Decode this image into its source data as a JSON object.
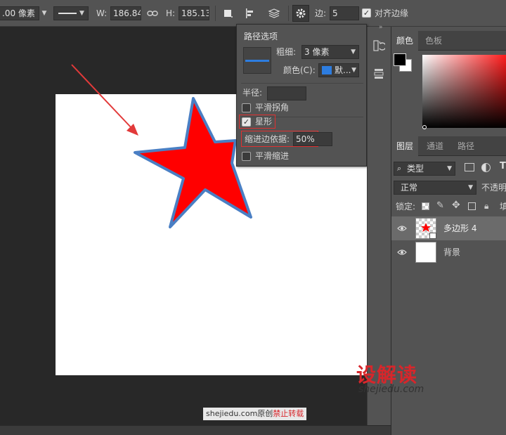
{
  "optbar": {
    "stroke_width_value": ".00 像素",
    "w_label": "W:",
    "w_value": "186.84 ",
    "h_label": "H:",
    "h_value": "185.13 ",
    "sides_label": "边:",
    "sides_value": "5",
    "align_edges_label": "对齐边缘",
    "align_edges_checked": true
  },
  "path_options": {
    "title": "路径选项",
    "weight_label": "粗细:",
    "weight_value": "3 像素",
    "color_label": "颜色(C):",
    "color_value": "默...",
    "color_swatch": "#2d7de0",
    "radius_label": "半径:",
    "radius_value": "",
    "smooth_corners_label": "平滑拐角",
    "smooth_corners_checked": false,
    "star_label": "星形",
    "star_checked": true,
    "indent_label": "缩进边依据:",
    "indent_value": "50%",
    "smooth_indent_label": "平滑缩进",
    "smooth_indent_checked": false
  },
  "color_panel": {
    "tabs": [
      "颜色",
      "色板"
    ],
    "foreground": "#000000",
    "background": "#ffffff",
    "hue": "#ff1a1a"
  },
  "layers_panel": {
    "tabs": [
      "图层",
      "通道",
      "路径"
    ],
    "filter_label": "类型",
    "blend_mode": "正常",
    "opacity_label": "不透明",
    "lock_label": "锁定:",
    "fill_label": "填",
    "layers": [
      {
        "name": "多边形 4",
        "selected": true
      },
      {
        "name": "背景",
        "selected": false
      }
    ]
  },
  "canvas": {
    "star_fill": "#ff0000",
    "star_stroke": "#4a7fc4",
    "arrow_color": "#e23a3a"
  },
  "watermark": {
    "logo": "设解读",
    "url": "shejiedu.com",
    "bar_site": "shejiedu.com原创",
    "bar_warning": "禁止转载"
  }
}
